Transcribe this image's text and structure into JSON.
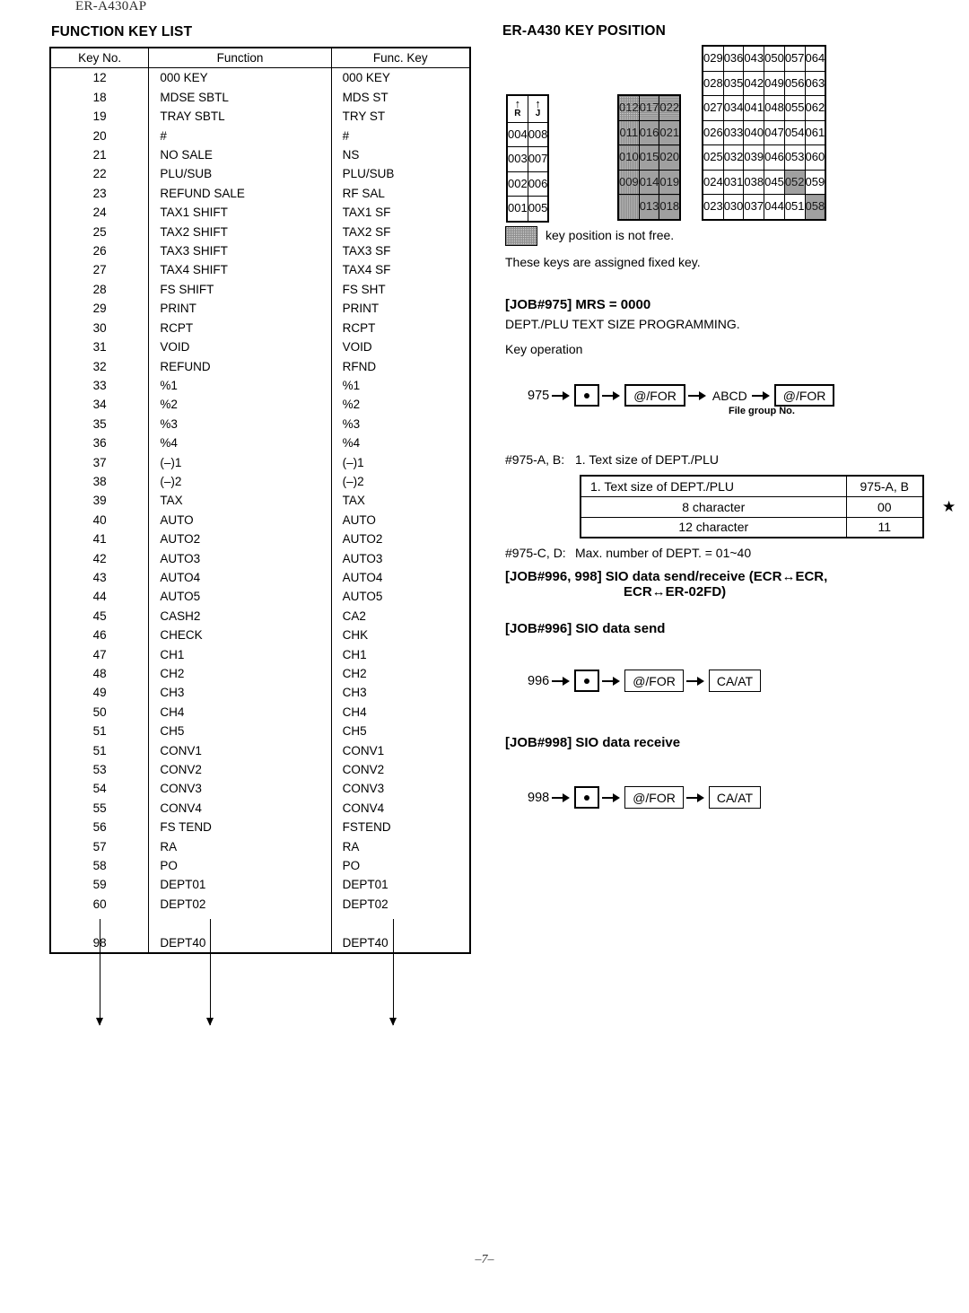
{
  "document": {
    "model_code": "ER-A430AP",
    "page_number": "–7–"
  },
  "function_key_list": {
    "title": "FUNCTION KEY LIST",
    "columns": [
      "Key No.",
      "Function",
      "Func. Key"
    ],
    "rows": [
      {
        "no": "12",
        "function": "000 KEY",
        "func_key": "000  KEY"
      },
      {
        "no": "18",
        "function": "MDSE SBTL",
        "func_key": "MDS ST"
      },
      {
        "no": "19",
        "function": "TRAY SBTL",
        "func_key": "TRY ST"
      },
      {
        "no": "20",
        "function": "#",
        "func_key": "#"
      },
      {
        "no": "21",
        "function": "NO SALE",
        "func_key": "NS"
      },
      {
        "no": "22",
        "function": "PLU/SUB",
        "func_key": "PLU/SUB"
      },
      {
        "no": "23",
        "function": "REFUND SALE",
        "func_key": "RF SAL"
      },
      {
        "no": "24",
        "function": "TAX1 SHIFT",
        "func_key": "TAX1 SF"
      },
      {
        "no": "25",
        "function": "TAX2 SHIFT",
        "func_key": "TAX2 SF"
      },
      {
        "no": "26",
        "function": "TAX3 SHIFT",
        "func_key": "TAX3 SF"
      },
      {
        "no": "27",
        "function": "TAX4 SHIFT",
        "func_key": "TAX4 SF"
      },
      {
        "no": "28",
        "function": "FS SHIFT",
        "func_key": "FS SHT"
      },
      {
        "no": "29",
        "function": "PRINT",
        "func_key": "PRINT"
      },
      {
        "no": "30",
        "function": "RCPT",
        "func_key": "RCPT"
      },
      {
        "no": "31",
        "function": "VOID",
        "func_key": "VOID"
      },
      {
        "no": "32",
        "function": "REFUND",
        "func_key": "RFND"
      },
      {
        "no": "33",
        "function": "%1",
        "func_key": "%1"
      },
      {
        "no": "34",
        "function": "%2",
        "func_key": "%2"
      },
      {
        "no": "35",
        "function": "%3",
        "func_key": "%3"
      },
      {
        "no": "36",
        "function": "%4",
        "func_key": "%4"
      },
      {
        "no": "37",
        "function": "(–)1",
        "func_key": "(–)1"
      },
      {
        "no": "38",
        "function": "(–)2",
        "func_key": "(–)2"
      },
      {
        "no": "39",
        "function": "TAX",
        "func_key": "TAX"
      },
      {
        "no": "40",
        "function": "AUTO",
        "func_key": "AUTO"
      },
      {
        "no": "41",
        "function": "AUTO2",
        "func_key": "AUTO2"
      },
      {
        "no": "42",
        "function": "AUTO3",
        "func_key": "AUTO3"
      },
      {
        "no": "43",
        "function": "AUTO4",
        "func_key": "AUTO4"
      },
      {
        "no": "44",
        "function": "AUTO5",
        "func_key": "AUTO5"
      },
      {
        "no": "45",
        "function": "CASH2",
        "func_key": "CA2"
      },
      {
        "no": "46",
        "function": "CHECK",
        "func_key": "CHK"
      },
      {
        "no": "47",
        "function": "CH1",
        "func_key": "CH1"
      },
      {
        "no": "48",
        "function": "CH2",
        "func_key": "CH2"
      },
      {
        "no": "49",
        "function": "CH3",
        "func_key": "CH3"
      },
      {
        "no": "50",
        "function": "CH4",
        "func_key": "CH4"
      },
      {
        "no": "51",
        "function": "CH5",
        "func_key": "CH5"
      },
      {
        "no": "51",
        "function": "CONV1",
        "func_key": "CONV1"
      },
      {
        "no": "53",
        "function": "CONV2",
        "func_key": "CONV2"
      },
      {
        "no": "54",
        "function": "CONV3",
        "func_key": "CONV3"
      },
      {
        "no": "55",
        "function": "CONV4",
        "func_key": "CONV4"
      },
      {
        "no": "56",
        "function": "FS TEND",
        "func_key": "FSTEND"
      },
      {
        "no": "57",
        "function": "RA",
        "func_key": "RA"
      },
      {
        "no": "58",
        "function": "PO",
        "func_key": "PO"
      },
      {
        "no": "59",
        "function": "DEPT01",
        "func_key": "DEPT01"
      },
      {
        "no": "60",
        "function": "DEPT02",
        "func_key": "DEPT02"
      }
    ],
    "last_row": {
      "no": "98",
      "function": "DEPT40",
      "func_key": "DEPT40"
    }
  },
  "key_position": {
    "title": "ER-A430 KEY POSITION",
    "left_block": {
      "header": [
        {
          "arrow": "↑",
          "label": "R"
        },
        {
          "arrow": "↑",
          "label": "J"
        }
      ],
      "rows": [
        [
          "004",
          "008"
        ],
        [
          "003",
          "007"
        ],
        [
          "002",
          "006"
        ],
        [
          "001",
          "005"
        ]
      ]
    },
    "middle_block": {
      "shaded": true,
      "rows": [
        [
          "012",
          "017",
          "022"
        ],
        [
          "011",
          "016",
          "021"
        ],
        [
          "010",
          "015",
          "020"
        ],
        [
          "009",
          "014",
          "019"
        ],
        [
          "",
          "013",
          "018"
        ]
      ]
    },
    "right_block": {
      "rows": [
        [
          "029",
          "036",
          "043",
          "050",
          "057",
          "064"
        ],
        [
          "028",
          "035",
          "042",
          "049",
          "056",
          "063"
        ],
        [
          "027",
          "034",
          "041",
          "048",
          "055",
          "062"
        ],
        [
          "026",
          "033",
          "040",
          "047",
          "054",
          "061"
        ],
        [
          "025",
          "032",
          "039",
          "046",
          "053",
          "060"
        ],
        [
          "024",
          "031",
          "038",
          "045",
          "052",
          "059"
        ],
        [
          "023",
          "030",
          "037",
          "044",
          "051",
          "058"
        ]
      ],
      "shaded_cells": [
        "052",
        "058"
      ]
    },
    "legend": {
      "swatch_text": "key position is not free.",
      "note": "These keys are assigned fixed key."
    }
  },
  "job975": {
    "heading": "[JOB#975] MRS = 0000",
    "subtitle": "DEPT./PLU TEXT SIZE PROGRAMMING.",
    "key_operation_label": "Key operation",
    "sequence": {
      "start": "975",
      "key1": "•",
      "key2": "@/FOR",
      "token": "ABCD",
      "key3": "@/FOR",
      "token_sublabel": "File group No."
    },
    "note_ab_label": "#975-A, B:",
    "note_ab_text": "1. Text size of DEPT./PLU",
    "table": {
      "header": [
        "1. Text size of DEPT./PLU",
        "975-A, B"
      ],
      "rows": [
        [
          "8 character",
          "00"
        ],
        [
          "12 character",
          "11"
        ]
      ],
      "star": "★"
    },
    "note_cd_label": "#975-C, D:",
    "note_cd_text": "Max. number of DEPT. = 01~40"
  },
  "job996_998": {
    "heading_line1": "[JOB#996, 998]  SIO data send/receive (ECR↔ECR,",
    "heading_line2": "ECR↔ER-02FD)"
  },
  "job996": {
    "heading": "[JOB#996]  SIO data send",
    "sequence": {
      "start": "996",
      "key1": "•",
      "key2": "@/FOR",
      "key3": "CA/AT"
    }
  },
  "job998": {
    "heading": "[JOB#998]  SIO data receive",
    "sequence": {
      "start": "998",
      "key1": "•",
      "key2": "@/FOR",
      "key3": "CA/AT"
    }
  }
}
